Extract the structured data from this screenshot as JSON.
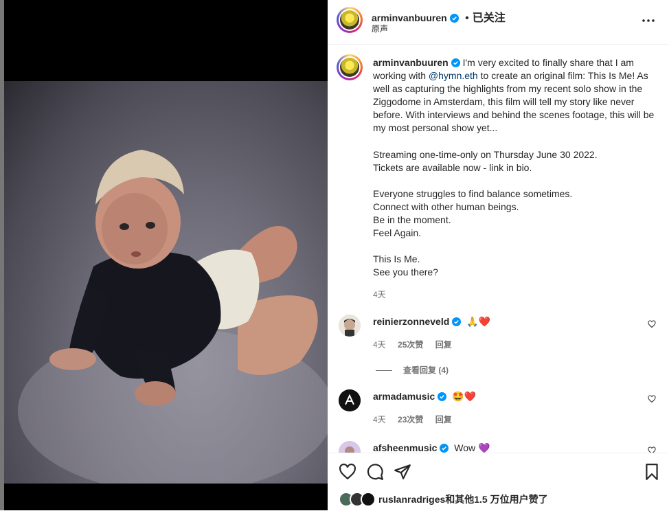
{
  "header": {
    "username": "arminvanbuuren",
    "separator": "•",
    "follow_status": "已关注",
    "audio": "原声"
  },
  "caption": {
    "username": "arminvanbuuren",
    "text_before_mention": "I'm very excited to finally share that I am working with ",
    "mention": "@hymn.eth",
    "text_after_mention": " to create an original film: This Is Me! As well as capturing the highlights from my recent solo show in the Ziggodome in Amsterdam, this film will tell my story like never before. With interviews and behind the scenes footage, this will be my most personal show yet...",
    "lines": [
      "Streaming one-time-only on Thursday June 30 2022.",
      "Tickets are available now - link in bio.",
      "",
      "Everyone struggles to find balance sometimes.",
      "Connect with other human beings.",
      "Be in the moment.",
      "Feel Again.",
      "",
      "This Is Me.",
      "See you there?"
    ],
    "age": "4天"
  },
  "comments": [
    {
      "username": "reinierzonneveld",
      "text": "🙏❤️",
      "age": "4天",
      "likes": "25次赞",
      "reply": "回复",
      "view_replies": "查看回复 (4)"
    },
    {
      "username": "armadamusic",
      "text": "🤩❤️",
      "age": "4天",
      "likes": "23次赞",
      "reply": "回复"
    },
    {
      "username": "afsheenmusic",
      "text": "Wow 💜"
    }
  ],
  "likes_summary": "ruslanradriges和其他1.5 万位用户赞了",
  "colors": {
    "verified": "#0095f6",
    "mention": "#00376b",
    "muted": "#737373",
    "heart_red": "#e0245e"
  }
}
